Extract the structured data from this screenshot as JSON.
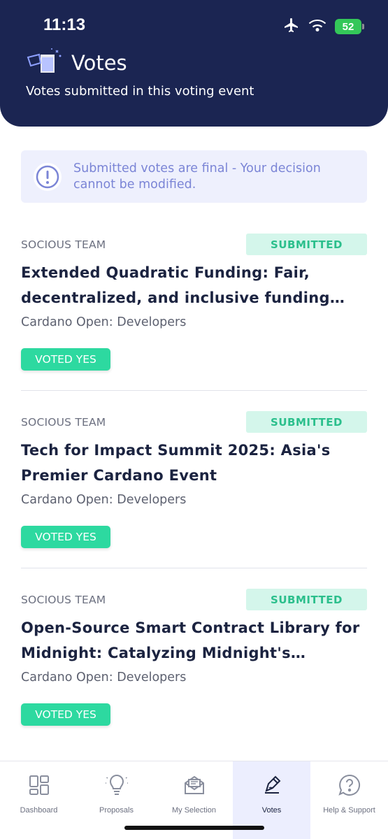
{
  "status_bar": {
    "time": "11:13",
    "battery": "52"
  },
  "header": {
    "title": "Votes",
    "subtitle": "Votes submitted in this voting event",
    "icon": "ballot-box-icon"
  },
  "notice": {
    "icon": "exclamation-circle-icon",
    "text": "Submitted votes are final - Your decision cannot be modified."
  },
  "votes": [
    {
      "team": "SOCIOUS TEAM",
      "status": "SUBMITTED",
      "title": "Extended Quadratic Funding: Fair, decentralized, and inclusive funding for…",
      "category": "Cardano Open: Developers",
      "vote": "VOTED YES"
    },
    {
      "team": "SOCIOUS TEAM",
      "status": "SUBMITTED",
      "title": "Tech for Impact Summit 2025: Asia's Premier Cardano Event",
      "category": "Cardano Open: Developers",
      "vote": "VOTED YES"
    },
    {
      "team": "SOCIOUS TEAM",
      "status": "SUBMITTED",
      "title": "Open-Source Smart Contract Library for Midnight: Catalyzing Midnight's…",
      "category": "Cardano Open: Developers",
      "vote": "VOTED YES"
    }
  ],
  "nav": {
    "items": [
      {
        "label": "Dashboard",
        "icon": "dashboard-icon"
      },
      {
        "label": "Proposals",
        "icon": "lightbulb-icon"
      },
      {
        "label": "My Selection",
        "icon": "envelope-icon"
      },
      {
        "label": "Votes",
        "icon": "vote-pen-icon",
        "active": true
      },
      {
        "label": "Help & Support",
        "icon": "help-chat-icon"
      }
    ]
  },
  "colors": {
    "header_bg": "#1b2552",
    "accent_green": "#2dd9a0",
    "notice_text": "#7b85d6",
    "active_nav_bg": "#eceefe"
  }
}
